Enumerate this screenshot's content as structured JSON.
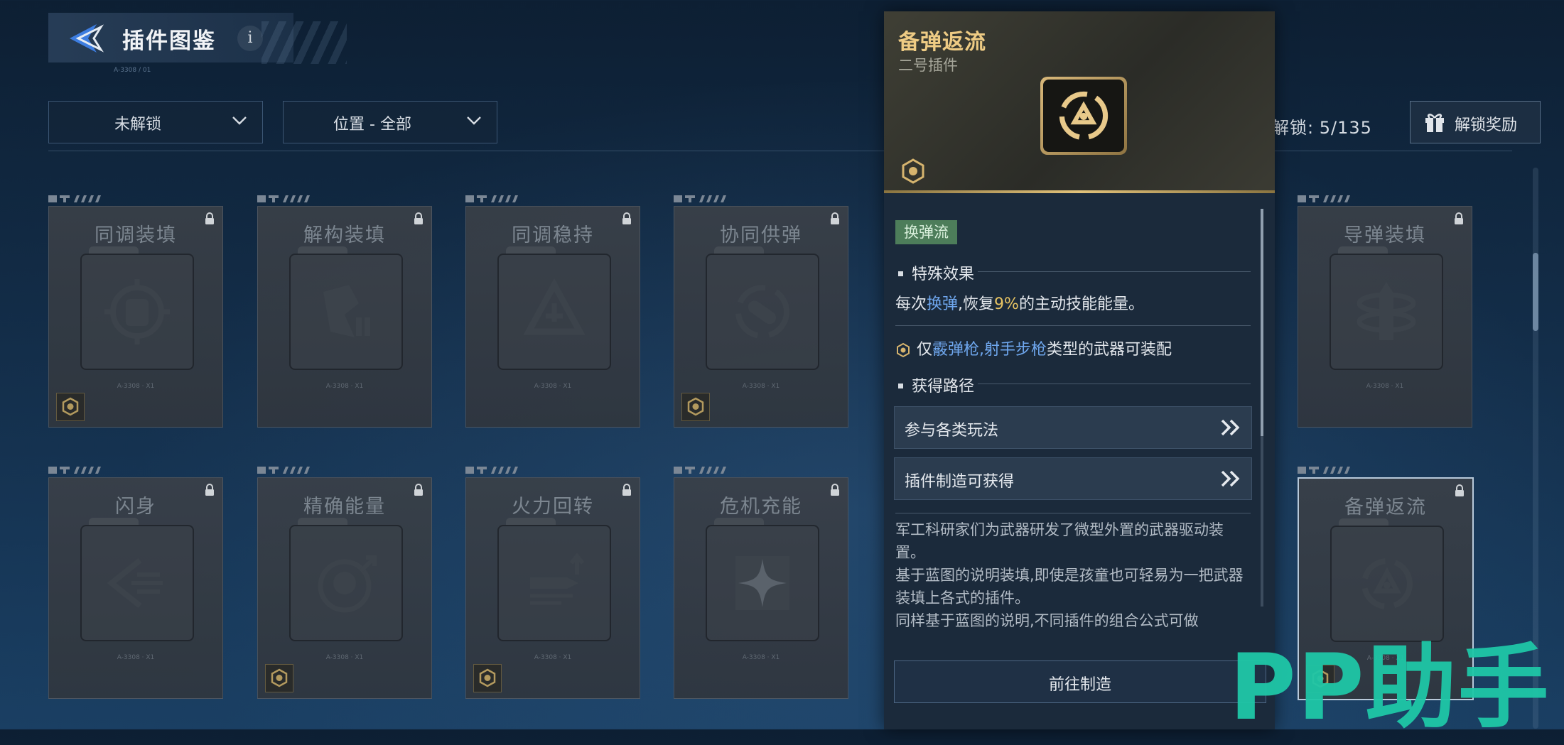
{
  "header": {
    "title": "插件图鉴",
    "info": "i",
    "sub_code": "A-3308 / 01"
  },
  "filters": [
    {
      "label": "未解锁"
    },
    {
      "label": "位置 - 全部"
    }
  ],
  "unlock": {
    "label": "解锁:",
    "count": "5/135"
  },
  "reward_button": {
    "label": "解锁奖励"
  },
  "cards": [
    {
      "name": "同调装填",
      "icon": "fist-target-icon",
      "has_badge": true,
      "code": "A-3308 · X1"
    },
    {
      "name": "解构装填",
      "icon": "shattered-shield-icon",
      "has_badge": false,
      "code": "A-3308 · X1"
    },
    {
      "name": "同调稳持",
      "icon": "triangle-cycle-icon",
      "has_badge": false,
      "code": "A-3308 · X1"
    },
    {
      "name": "协同供弹",
      "icon": "bullet-swap-icon",
      "has_badge": true,
      "code": "A-3308 · X1"
    },
    {
      "name": "导弹装填",
      "icon": "missile-rings-icon",
      "has_badge": false,
      "code": "A-3308 · X1"
    },
    {
      "name": "闪身",
      "icon": "dash-runner-icon",
      "has_badge": false,
      "code": "A-3308 · X1"
    },
    {
      "name": "精确能量",
      "icon": "skull-target-icon",
      "has_badge": true,
      "code": "A-3308 · X1"
    },
    {
      "name": "火力回转",
      "icon": "bullet-up-arrow-icon",
      "has_badge": true,
      "code": "A-3308 · X1"
    },
    {
      "name": "危机充能",
      "icon": "star-diamond-icon",
      "has_badge": false,
      "code": "A-3308 · X1"
    },
    {
      "name": "备弹返流",
      "icon": "cycle-triangle-icon",
      "has_badge": true,
      "code": "A-3308 · X1",
      "selected": true
    }
  ],
  "detail": {
    "name": "备弹返流",
    "slot": "二号插件",
    "tag": "换弹流",
    "special_effect_title": "特殊效果",
    "effect": {
      "prefix": "每次",
      "keyword": "换弹",
      "middle": ",恢复",
      "value": "9%",
      "suffix": "的主动技能能量。"
    },
    "weapon": {
      "prefix": "仅",
      "types": "霰弹枪,射手步枪",
      "suffix": "类型的武器可装配"
    },
    "obtain_title": "获得路径",
    "paths": [
      "参与各类玩法",
      "插件制造可获得"
    ],
    "description": [
      "军工科研家们为武器研发了微型外置的武器驱动装置。",
      "基于蓝图的说明装填,即使是孩童也可轻易为一把武器装填上各式的插件。",
      "同样基于蓝图的说明,不同插件的组合公式可做"
    ],
    "goto_button": "前往制造"
  },
  "watermark": "PP助手",
  "colors": {
    "accent_gold": "#eecb84",
    "tag_green": "#4d7d5a",
    "keyword_blue": "#6fa7ee",
    "value_yellow": "#e8c463",
    "watermark": "#1fc7a7"
  }
}
